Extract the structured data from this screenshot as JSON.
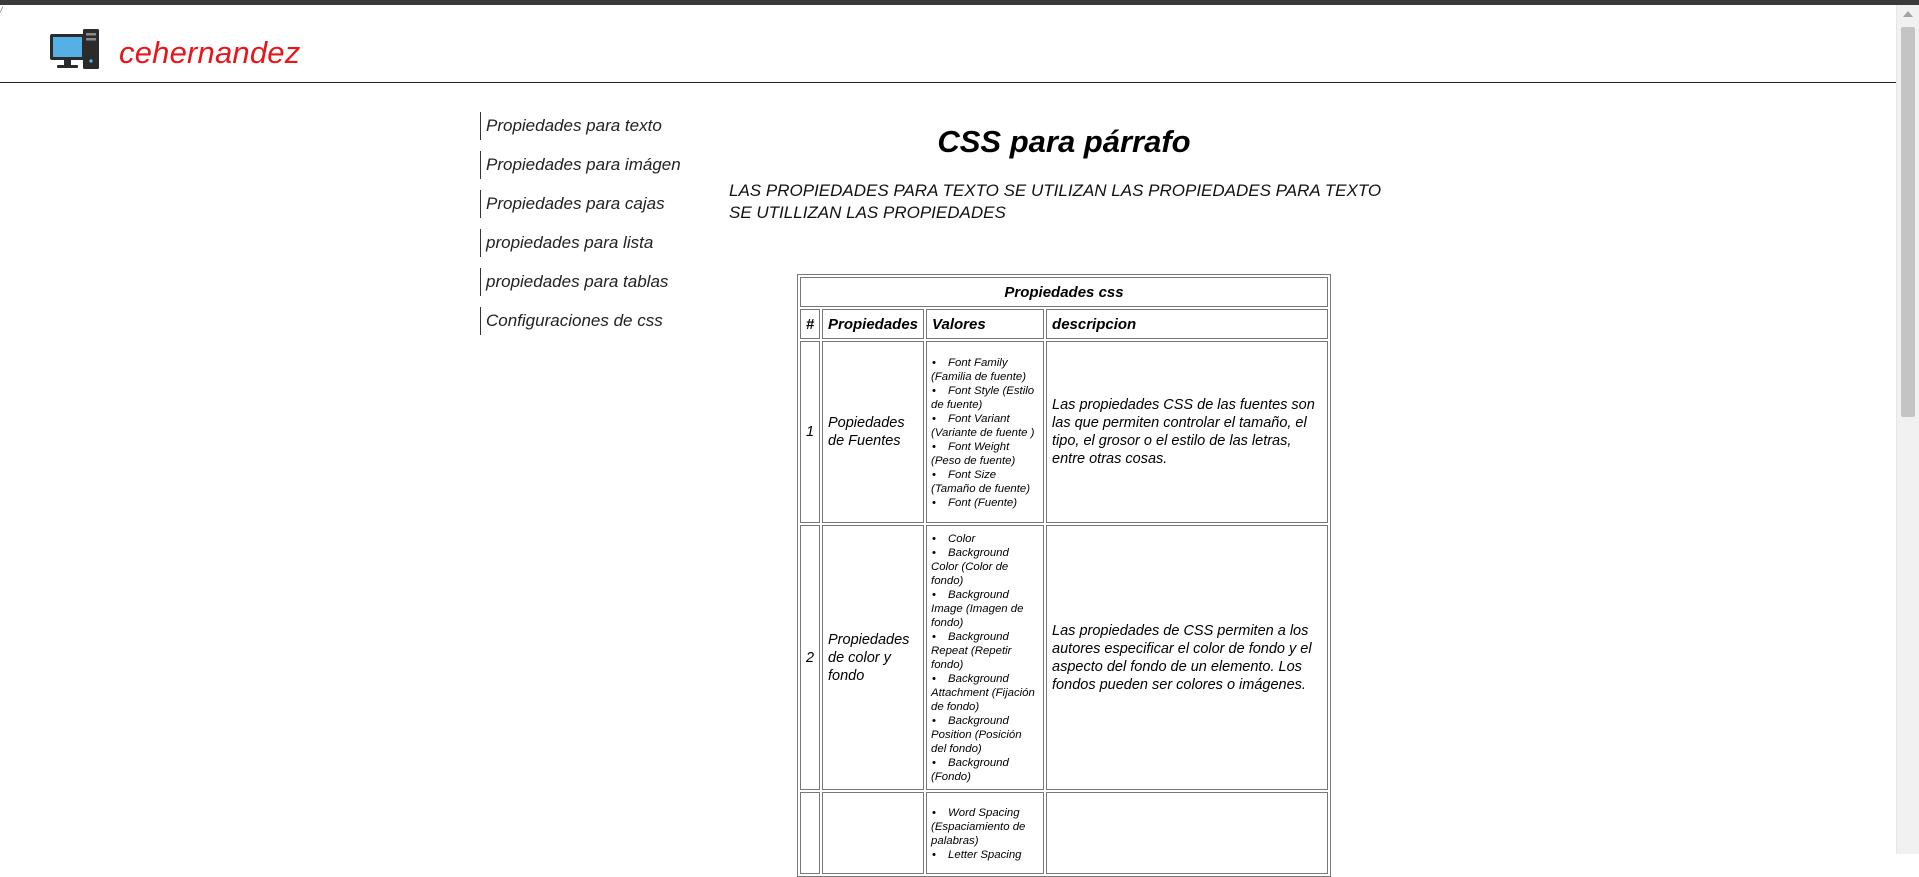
{
  "corner_mark": "/",
  "header": {
    "brand": "cehernandez",
    "logo_icon": "desktop-computer-icon",
    "brand_color": "#e8161b"
  },
  "nav": {
    "items": [
      "Propiedades para texto",
      "Propiedades para imágen",
      "Propiedades para cajas",
      "propiedades para lista",
      "propiedades para tablas",
      "Configuraciones de css"
    ]
  },
  "main": {
    "title": "CSS para párrafo",
    "intro": "LAS PROPIEDADES PARA TEXTO SE UTILIZAN LAS PROPIEDADES PARA TEXTO SE UTILLIZAN LAS PROPIEDADES"
  },
  "table": {
    "caption": "Propiedades css",
    "headers": [
      "#",
      "Propiedades",
      "Valores",
      "descripcion"
    ],
    "rows": [
      {
        "num": "1",
        "prop": "Popiedades de Fuentes",
        "values": [
          "Font Family (Familia de fuente)",
          "Font Style (Estilo de fuente)",
          "Font Variant (Variante de fuente )",
          "Font Weight (Peso de fuente)",
          "Font Size (Tamaño de fuente)",
          "Font (Fuente)"
        ],
        "desc": "Las propiedades CSS de las fuentes son las que permiten controlar el tamaño, el tipo, el grosor o el estilo de las letras, entre otras cosas."
      },
      {
        "num": "2",
        "prop": "Propiedades de color y fondo",
        "values": [
          "Color",
          "Background Color (Color de fondo)",
          "Background Image (Imagen de fondo)",
          "Background Repeat (Repetir fondo)",
          "Background Attachment (Fijación de fondo)",
          "Background Position (Posición del fondo)",
          "Background (Fondo)"
        ],
        "desc": "Las propiedades de CSS permiten a los autores especificar el color de fondo y el aspecto del fondo de un elemento. Los fondos pueden ser colores o imágenes."
      },
      {
        "num": "",
        "prop": "",
        "values": [
          "Word Spacing (Espaciamiento de palabras)",
          "Letter Spacing"
        ],
        "desc": ""
      }
    ]
  }
}
